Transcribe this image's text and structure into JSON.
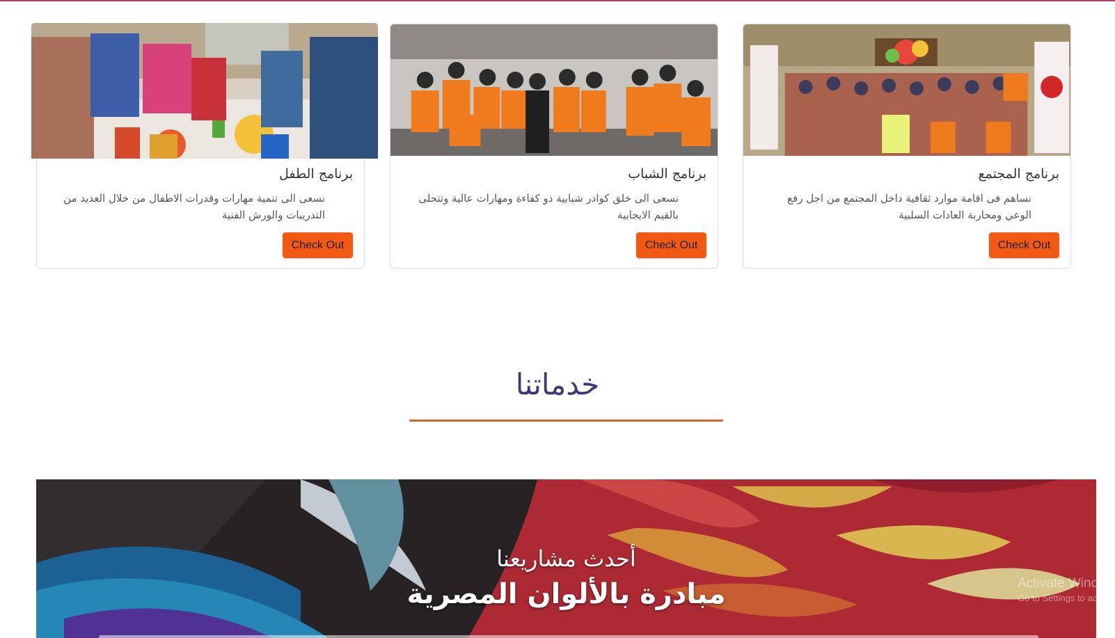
{
  "programs": [
    {
      "id": "child",
      "title": "برنامج الطفل",
      "text": "نسعى الى تنمية مهارات وقدرات الاطفال من خلال العديد من التدريبات والورش الفنية",
      "button": "Check Out",
      "image_alt": "children-painting-photo"
    },
    {
      "id": "youth",
      "title": "برنامج الشباب",
      "text": "نسعى الى خلق كوادر شبابية ذو كفاءة ومهارات عالية وتتحلى بالقيم الايجابية",
      "button": "Check Out",
      "image_alt": "youth-volunteers-photo"
    },
    {
      "id": "community",
      "title": "برنامج المجتمع",
      "text": "نساهم فى اقامة موارد ثقافية داخل المجتمع من اجل رفع الوعي ومحاربة العادات السلبية",
      "button": "Check Out",
      "image_alt": "community-event-photo"
    }
  ],
  "services": {
    "title": "خدماتنا"
  },
  "latest_project": {
    "subtitle": "أحدث مشاريعنا",
    "title": "مبادرة بالألوان المصرية"
  },
  "watermark": {
    "line1": "Activate Window",
    "line2": "Go to Settings to activ"
  },
  "colors": {
    "accent": "#f25a13",
    "heading": "#3b3a78",
    "underline": "#e0602a"
  }
}
